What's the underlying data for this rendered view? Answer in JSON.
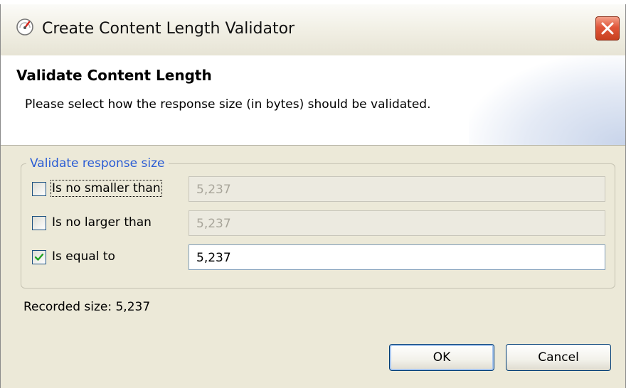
{
  "window": {
    "title": "Create Content Length Validator",
    "icon": "gauge-icon",
    "close_icon": "close-icon"
  },
  "header": {
    "title": "Validate Content Length",
    "description": "Please select how the response size (in bytes) should be validated."
  },
  "group": {
    "legend": "Validate response size",
    "rows": [
      {
        "label": "Is no smaller than",
        "checked": false,
        "value": "5,237",
        "enabled": false
      },
      {
        "label": "Is no larger than",
        "checked": false,
        "value": "5,237",
        "enabled": false
      },
      {
        "label": "Is equal to",
        "checked": true,
        "value": "5,237",
        "enabled": true
      }
    ]
  },
  "recorded": {
    "label": "Recorded size:  5,237"
  },
  "buttons": {
    "ok": "OK",
    "cancel": "Cancel"
  },
  "colors": {
    "legend": "#2a5cd4",
    "close_button": "#e0563a",
    "checkmark": "#21a121"
  }
}
